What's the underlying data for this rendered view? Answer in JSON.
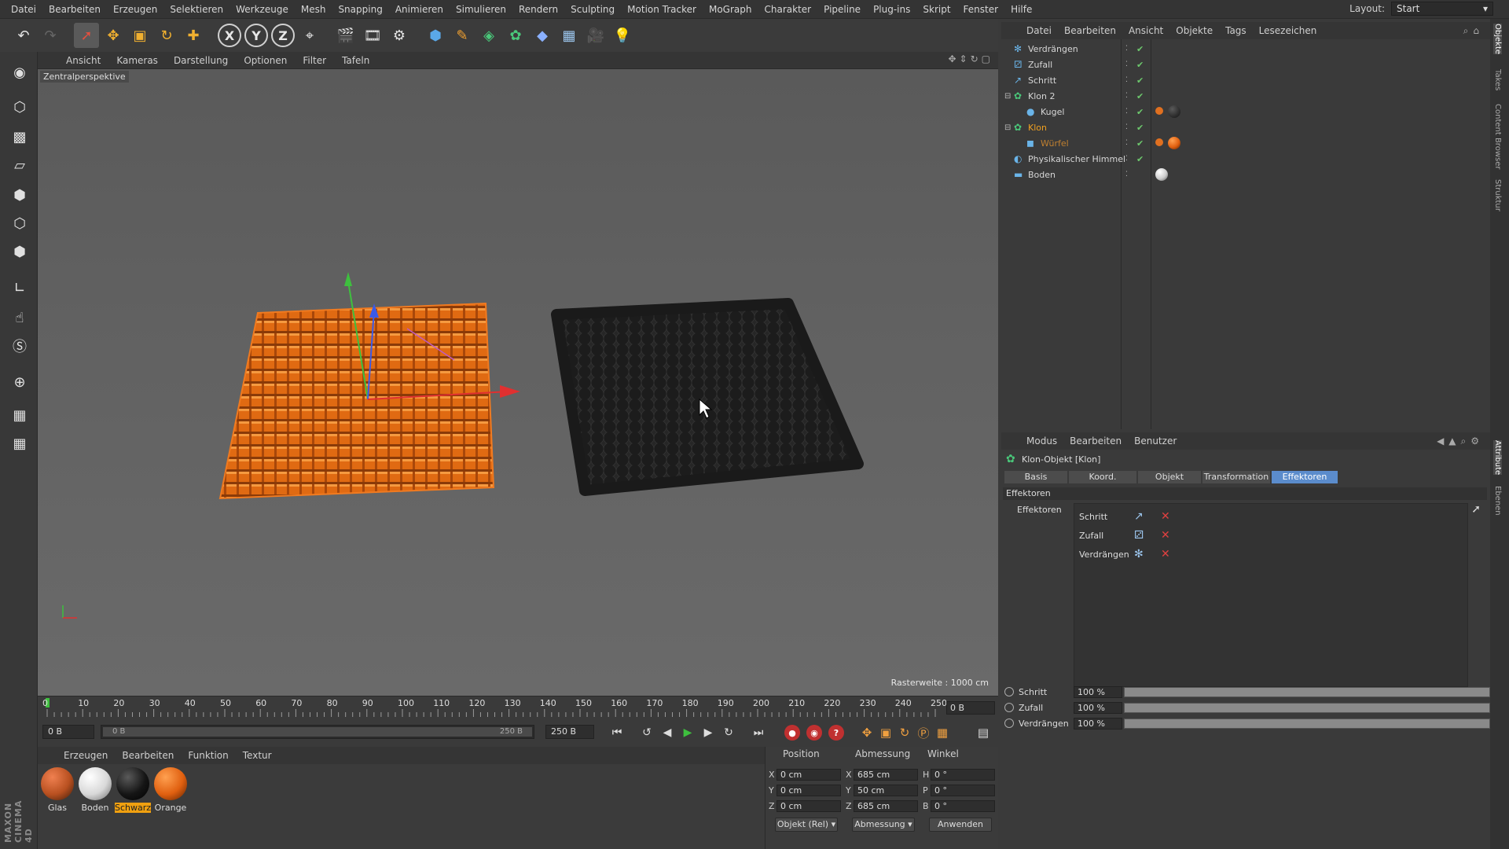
{
  "menubar": {
    "items": [
      "Datei",
      "Bearbeiten",
      "Erzeugen",
      "Selektieren",
      "Werkzeuge",
      "Mesh",
      "Snapping",
      "Animieren",
      "Simulieren",
      "Rendern",
      "Sculpting",
      "Motion Tracker",
      "MoGraph",
      "Charakter",
      "Pipeline",
      "Plug-ins",
      "Skript",
      "Fenster",
      "Hilfe"
    ],
    "layout_label": "Layout:",
    "layout_value": "Start"
  },
  "viewport": {
    "menu": [
      "Ansicht",
      "Kameras",
      "Darstellung",
      "Optionen",
      "Filter",
      "Tafeln"
    ],
    "camera": "Zentralperspektive",
    "raster": "Rasterweite : 1000 cm"
  },
  "timeline": {
    "ticks": [
      "0",
      "10",
      "20",
      "30",
      "40",
      "50",
      "60",
      "70",
      "80",
      "90",
      "100",
      "110",
      "120",
      "130",
      "140",
      "150",
      "160",
      "170",
      "180",
      "190",
      "200",
      "210",
      "220",
      "230",
      "240",
      "250"
    ],
    "current_frame": "0 B",
    "start_field": "0 B",
    "range_start": "0 B",
    "range_end": "250 B",
    "end_field": "250 B"
  },
  "material_manager": {
    "menu": [
      "Erzeugen",
      "Bearbeiten",
      "Funktion",
      "Textur"
    ],
    "materials": [
      {
        "name": "Glas",
        "color": "#b85020"
      },
      {
        "name": "Boden",
        "color": "#e8e8e8"
      },
      {
        "name": "Schwarz",
        "color": "#151515"
      },
      {
        "name": "Orange",
        "color": "#e06010"
      }
    ],
    "selected": "Schwarz"
  },
  "coordinates": {
    "headers": [
      "Position",
      "Abmessung",
      "Winkel"
    ],
    "rows": [
      {
        "axis": "X",
        "pos": "0 cm",
        "dim_axis": "X",
        "dim": "685 cm",
        "ang_axis": "H",
        "ang": "0 °"
      },
      {
        "axis": "Y",
        "pos": "0 cm",
        "dim_axis": "Y",
        "dim": "50 cm",
        "ang_axis": "P",
        "ang": "0 °"
      },
      {
        "axis": "Z",
        "pos": "0 cm",
        "dim_axis": "Z",
        "dim": "685 cm",
        "ang_axis": "B",
        "ang": "0 °"
      }
    ],
    "mode": "Objekt (Rel)",
    "size_mode": "Abmessung",
    "apply": "Anwenden"
  },
  "object_manager": {
    "menu": [
      "Datei",
      "Bearbeiten",
      "Ansicht",
      "Objekte",
      "Tags",
      "Lesezeichen"
    ],
    "objects": [
      {
        "name": "Verdrängen",
        "icon": "effector-icon",
        "indent": 0
      },
      {
        "name": "Zufall",
        "icon": "effector-icon",
        "indent": 0
      },
      {
        "name": "Schritt",
        "icon": "effector-icon",
        "indent": 0
      },
      {
        "name": "Klon 2",
        "icon": "cloner-icon",
        "indent": 0
      },
      {
        "name": "Kugel",
        "icon": "sphere-icon",
        "indent": 1
      },
      {
        "name": "Klon",
        "icon": "cloner-icon",
        "indent": 0
      },
      {
        "name": "Würfel",
        "icon": "cube-icon",
        "indent": 1
      },
      {
        "name": "Physikalischer Himmel",
        "icon": "sky-icon",
        "indent": 0
      },
      {
        "name": "Boden",
        "icon": "floor-icon",
        "indent": 0
      }
    ]
  },
  "attribute_manager": {
    "menu": [
      "Modus",
      "Bearbeiten",
      "Benutzer"
    ],
    "title": "Klon-Objekt [Klon]",
    "tabs": [
      "Basis",
      "Koord.",
      "Objekt",
      "Transformation",
      "Effektoren"
    ],
    "active_tab": "Effektoren",
    "section": "Effektoren",
    "list_label": "Effektoren",
    "effectors": [
      "Schritt",
      "Zufall",
      "Verdrängen"
    ],
    "strengths": [
      {
        "name": "Schritt",
        "value": "100 %",
        "fraction": 1.0
      },
      {
        "name": "Zufall",
        "value": "100 %",
        "fraction": 1.0
      },
      {
        "name": "Verdrängen",
        "value": "100 %",
        "fraction": 1.0
      }
    ]
  },
  "right_tabs": [
    "Objekte",
    "Takes",
    "Content Browser",
    "Struktur",
    "Attribute",
    "Ebenen"
  ]
}
